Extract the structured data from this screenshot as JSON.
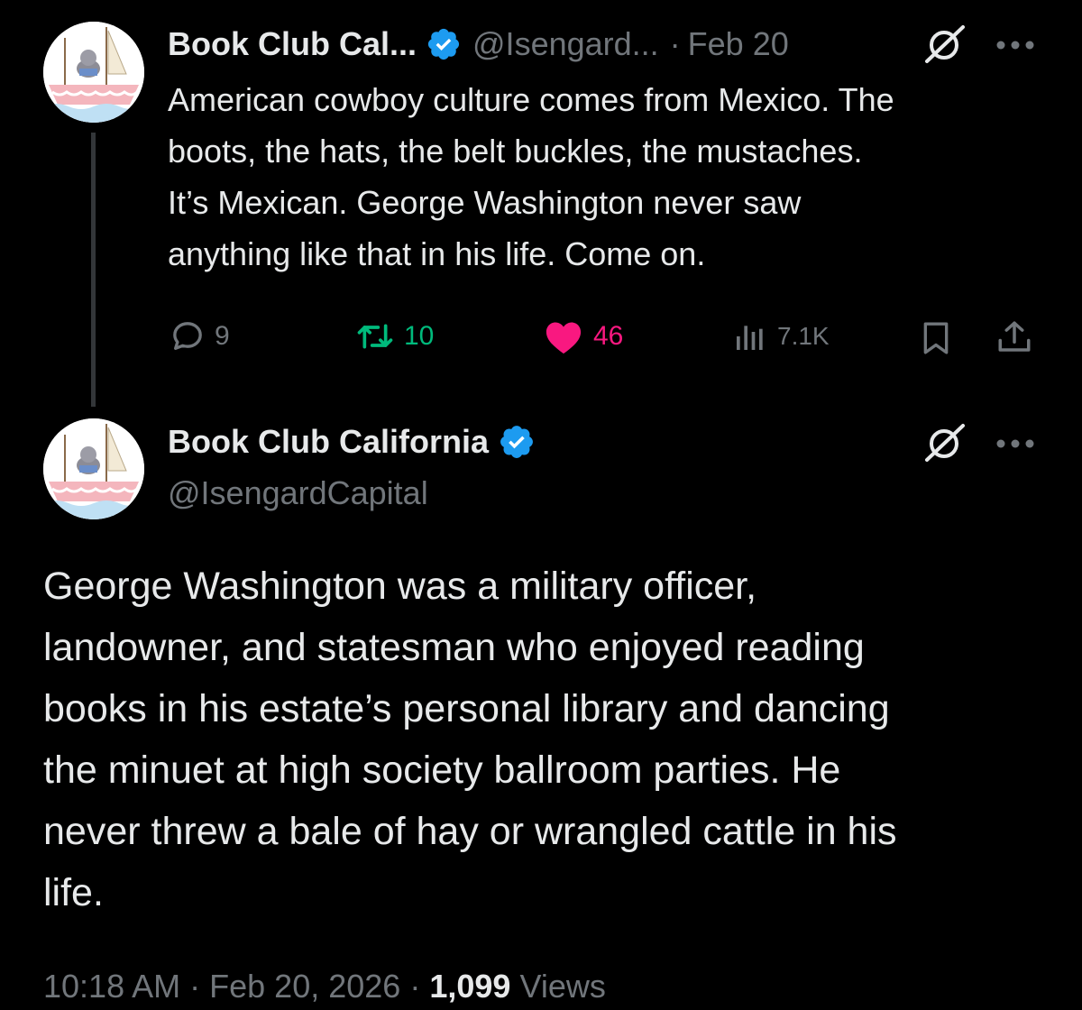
{
  "colors": {
    "background": "#000000",
    "text": "#e7e9ea",
    "muted": "#71767b",
    "verified": "#1d9bf0",
    "retweet": "#00ba7c",
    "like": "#f91880"
  },
  "parent_tweet": {
    "display_name": "Book Club Cal...",
    "handle": "@Isengard...",
    "separator": "·",
    "date": "Feb 20",
    "text_lines": [
      "American cowboy culture comes from Mexico. The",
      "boots, the hats, the belt buckles, the mustaches.",
      "It’s Mexican. George Washington never saw",
      "anything like that in his life. Come on."
    ],
    "replies": "9",
    "reposts": "10",
    "likes": "46",
    "views": "7.1K",
    "icons": [
      "avatar",
      "verified-badge-icon",
      "grok-icon",
      "more-icon",
      "reply-icon",
      "repost-icon",
      "heart-icon",
      "views-icon",
      "bookmark-icon",
      "share-icon"
    ]
  },
  "main_tweet": {
    "display_name": "Book Club California",
    "handle": "@IsengardCapital",
    "text_lines": [
      "George Washington was a military officer,",
      "landowner, and statesman who enjoyed reading",
      "books in his estate’s personal library and dancing",
      "the minuet at high society ballroom parties. He",
      "never threw a bale of hay or wrangled cattle in his",
      "life."
    ],
    "time": "10:18 AM",
    "separator": "·",
    "full_date": "Feb 20, 2026",
    "separator2": "·",
    "view_count": "1,099",
    "views_label": "Views"
  }
}
